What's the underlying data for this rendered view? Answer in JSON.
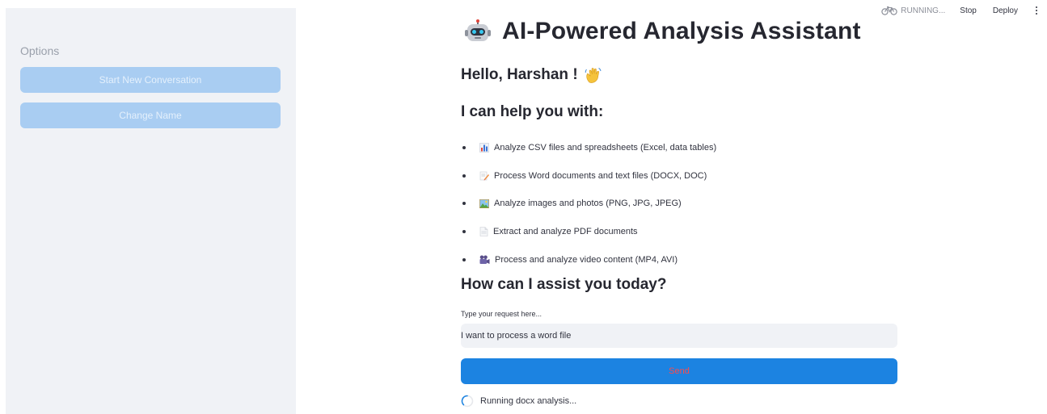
{
  "sidebar": {
    "title": "Options",
    "buttons": [
      {
        "label": "Start New Conversation"
      },
      {
        "label": "Change Name"
      }
    ]
  },
  "toolbar": {
    "status": "RUNNING...",
    "stop_label": "Stop",
    "deploy_label": "Deploy",
    "menu_icon": "kebab-menu-icon"
  },
  "main": {
    "title": "AI-Powered Analysis Assistant",
    "title_icon": "robot-icon",
    "greeting": "Hello, Harshan !",
    "greeting_icon": "waving-hand-icon",
    "help_heading": "I can help you with:",
    "features": [
      {
        "icon": "bar-chart-icon",
        "text": "Analyze CSV files and spreadsheets (Excel, data tables)"
      },
      {
        "icon": "memo-icon",
        "text": "Process Word documents and text files (DOCX, DOC)"
      },
      {
        "icon": "picture-icon",
        "text": "Analyze images and photos (PNG, JPG, JPEG)"
      },
      {
        "icon": "document-icon",
        "text": "Extract and analyze PDF documents"
      },
      {
        "icon": "video-camera-icon",
        "text": "Process and analyze video content (MP4, AVI)"
      }
    ],
    "assist_heading": "How can I assist you today?",
    "input_label": "Type your request here...",
    "input_value": "I want to process a word file",
    "send_label": "Send",
    "status_text": "Running docx analysis..."
  },
  "colors": {
    "sidebar_bg": "#f0f2f6",
    "sidebar_button": "#a9cdf2",
    "send_button": "#1c83e1",
    "send_text": "#ff4b4b",
    "input_bg": "#f0f2f6"
  }
}
